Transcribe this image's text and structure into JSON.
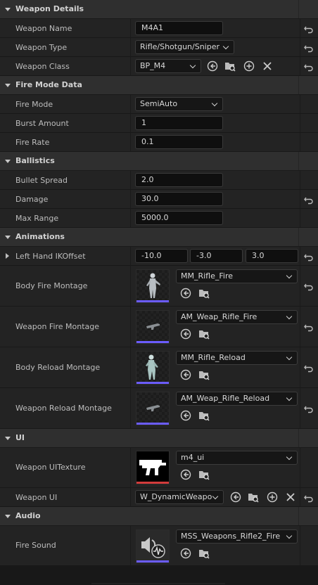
{
  "sections": {
    "weapon_details": "Weapon Details",
    "fire_mode_data": "Fire Mode Data",
    "ballistics": "Ballistics",
    "animations": "Animations",
    "ui": "UI",
    "audio": "Audio"
  },
  "weapon_name": {
    "label": "Weapon Name",
    "value": "M4A1"
  },
  "weapon_type": {
    "label": "Weapon Type",
    "value": "Rifle/Shotgun/Sniper"
  },
  "weapon_class": {
    "label": "Weapon Class",
    "value": "BP_M4"
  },
  "fire_mode": {
    "label": "Fire Mode",
    "value": "SemiAuto"
  },
  "burst_amount": {
    "label": "Burst Amount",
    "value": "1"
  },
  "fire_rate": {
    "label": "Fire Rate",
    "value": "0.1"
  },
  "bullet_spread": {
    "label": "Bullet Spread",
    "value": "2.0"
  },
  "damage": {
    "label": "Damage",
    "value": "30.0"
  },
  "max_range": {
    "label": "Max Range",
    "value": "5000.0"
  },
  "left_hand_ik": {
    "label": "Left Hand IKOffset",
    "x": "-10.0",
    "y": "-3.0",
    "z": "3.0"
  },
  "body_fire_montage": {
    "label": "Body Fire Montage",
    "asset": "MM_Rifle_Fire"
  },
  "weapon_fire_montage": {
    "label": "Weapon Fire Montage",
    "asset": "AM_Weap_Rifle_Fire"
  },
  "body_reload_montage": {
    "label": "Body Reload Montage",
    "asset": "MM_Rifle_Reload"
  },
  "weapon_reload_montage": {
    "label": "Weapon Reload Montage",
    "asset": "AM_Weap_Rifle_Reload"
  },
  "weapon_ui_texture": {
    "label": "Weapon UITexture",
    "asset": "m4_ui"
  },
  "weapon_ui": {
    "label": "Weapon UI",
    "value": "W_DynamicWeapo"
  },
  "fire_sound": {
    "label": "Fire Sound",
    "asset": "MSS_Weapons_Rifle2_Fire"
  },
  "colors": {
    "anim_bar": "#6b5cff",
    "texture_bar": "#d23b3b",
    "sound_bar": "#6b5cff"
  },
  "icons": {
    "reset": "reset-arrow-icon",
    "use_selected": "use-selected-icon",
    "browse": "browse-icon",
    "add": "add-icon",
    "clear": "clear-icon"
  }
}
